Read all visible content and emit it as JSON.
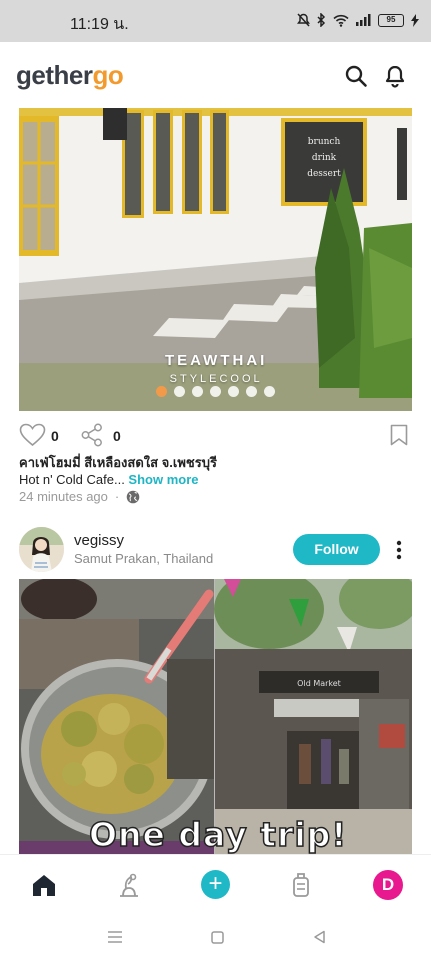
{
  "status_bar": {
    "time": "11:19 น.",
    "battery": "95"
  },
  "header": {
    "logo_part1": "gether",
    "logo_part2": "go",
    "search_icon": "search-icon",
    "notifications_icon": "bell-icon"
  },
  "post1": {
    "image_watermark_line1": "TEAWTHAI",
    "image_watermark_line2": "STYLECOOL",
    "image_sign_text": "brunch drink dessert",
    "image_count": 7,
    "active_image_index": 0,
    "likes": "0",
    "shares": "0",
    "caption_line1": "คาเฟ่โฮมมี่ สีเหลืองสดใส จ.เพชรบุรี",
    "caption_line2": "Hot n' Cold Cafe... ",
    "show_more": "Show more",
    "time_ago": "24 minutes ago",
    "separator": "·"
  },
  "post2": {
    "username": "vegissy",
    "location": "Samut Prakan, Thailand",
    "follow_label": "Follow",
    "image_caption": "One day trip!"
  },
  "bottom_nav": {
    "items": [
      "home-icon",
      "explore-icon",
      "add-icon",
      "trips-icon",
      "profile-avatar"
    ],
    "plus_label": "+",
    "avatar_initial": "D"
  },
  "colors": {
    "accent": "#1fb8c6",
    "logo_orange": "#f29a2e",
    "avatar_pink": "#e8188e"
  }
}
